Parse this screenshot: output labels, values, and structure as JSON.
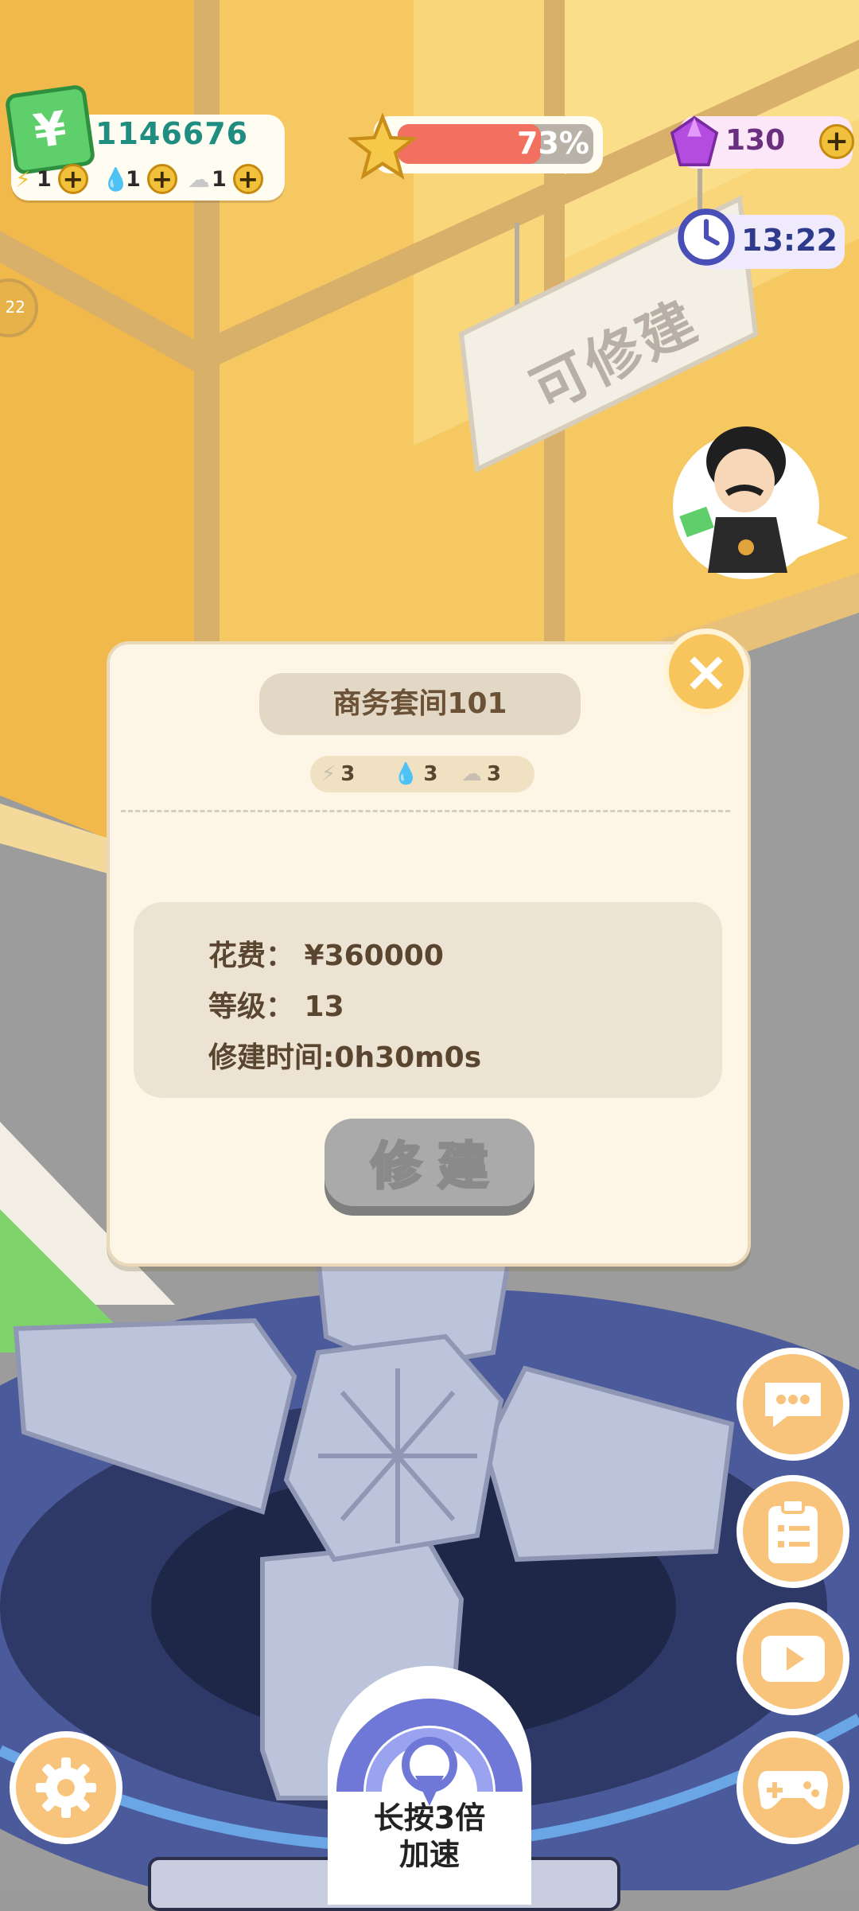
{
  "hud": {
    "money": "1146676",
    "money_symbol": "¥",
    "resources": [
      {
        "icon": "lightning-icon",
        "value": "1"
      },
      {
        "icon": "water-drop-icon",
        "value": "1"
      },
      {
        "icon": "cloud-icon",
        "value": "1"
      }
    ],
    "plus_label": "+",
    "level_progress_label": "73%",
    "level_progress": 0.73,
    "gems": "130",
    "timer": "13:22",
    "side_badge": "22"
  },
  "scene": {
    "sign_text": "可修建"
  },
  "dialog": {
    "title": "商务套间101",
    "requirements": [
      {
        "icon": "lightning-icon",
        "value": "3"
      },
      {
        "icon": "water-drop-icon",
        "value": "3"
      },
      {
        "icon": "cloud-icon",
        "value": "3"
      }
    ],
    "cost_line": "花费：  ¥360000",
    "level_line": "等级：  13",
    "time_line": "修建时间:0h30m0s",
    "build_button": "修建",
    "close_label": "×"
  },
  "speed_button": {
    "line1": "长按3倍",
    "line2": "加速"
  },
  "colors": {
    "accent_orange": "#f8c37a",
    "money_teal": "#1f8d80",
    "level_fill": "#f2705f",
    "build_disabled": "#aaaaaa"
  }
}
